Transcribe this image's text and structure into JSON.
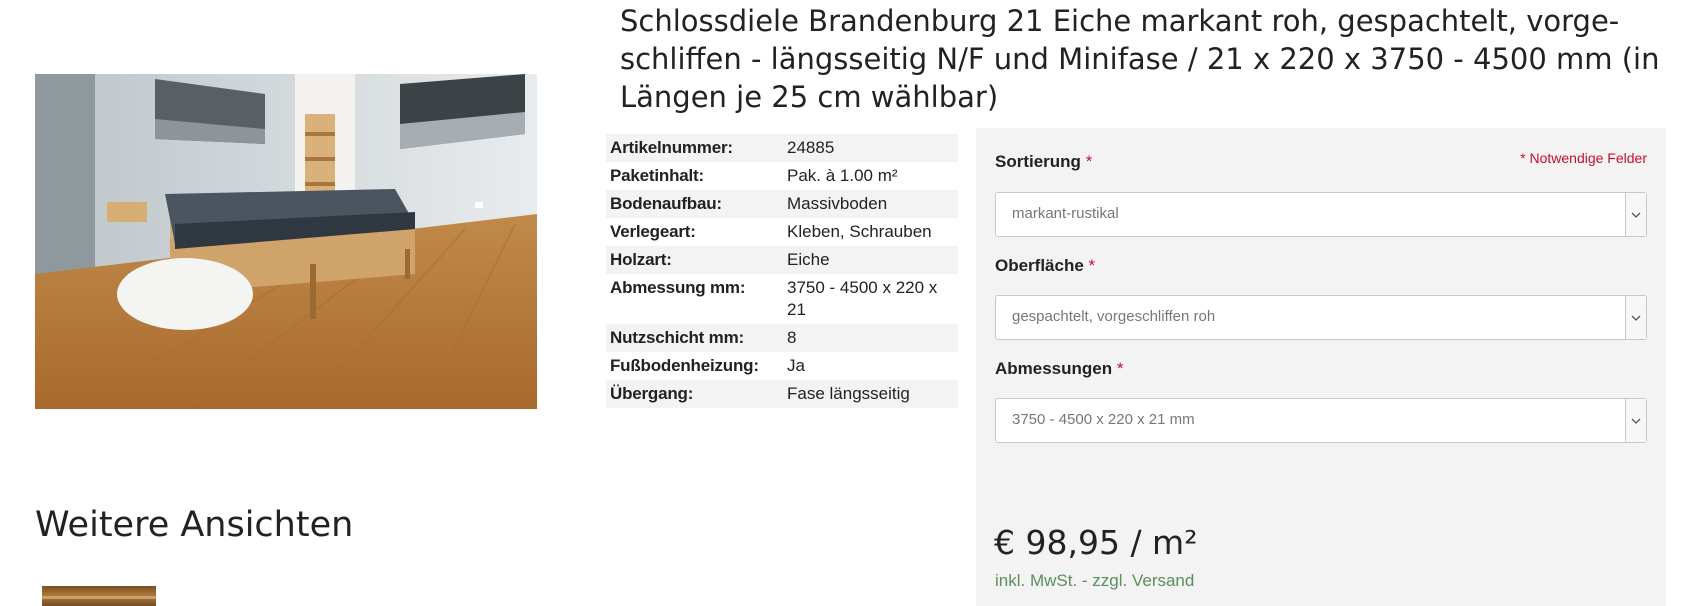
{
  "product": {
    "title": "Schlossdiele Brandenburg 21 Eiche markant roh, gespachtelt, vorge-schliffen - längsseitig N/F und Minifase / 21 x 220 x 3750 - 4500 mm (in Längen je 25 cm wählbar)",
    "image_alt": "bedroom with oak flooring",
    "views_heading": "Weitere Ansichten"
  },
  "specs": [
    {
      "key": "Artikelnummer:",
      "value": "24885"
    },
    {
      "key": "Paketinhalt:",
      "value": "Pak. à 1.00 m²"
    },
    {
      "key": "Bodenaufbau:",
      "value": "Massivboden"
    },
    {
      "key": "Verlegeart:",
      "value": "Kleben, Schrauben"
    },
    {
      "key": "Holzart:",
      "value": "Eiche"
    },
    {
      "key": "Abmessung mm:",
      "value": "3750 - 4500 x 220 x 21"
    },
    {
      "key": "Nutzschicht mm:",
      "value": "8"
    },
    {
      "key": "Fußbodenheizung:",
      "value": "Ja"
    },
    {
      "key": "Übergang:",
      "value": "Fase längsseitig"
    }
  ],
  "config": {
    "required_note": "* Notwendige Felder",
    "required_marker": "*",
    "fields": [
      {
        "label": "Sortierung",
        "value": "markant-rustikal"
      },
      {
        "label": "Oberfläche",
        "value": "gespachtelt, vorgeschliffen roh"
      },
      {
        "label": "Abmessungen",
        "value": "3750 - 4500 x 220 x 21 mm"
      }
    ],
    "price": "€ 98,95 / m²",
    "tax_note": "inkl. MwSt. - zzgl. Versand"
  },
  "colors": {
    "required": "#c8102e",
    "tax_note": "#5b8f5b",
    "panel_bg": "#f3f3f3"
  },
  "icons": [
    "chevron-down-icon"
  ]
}
